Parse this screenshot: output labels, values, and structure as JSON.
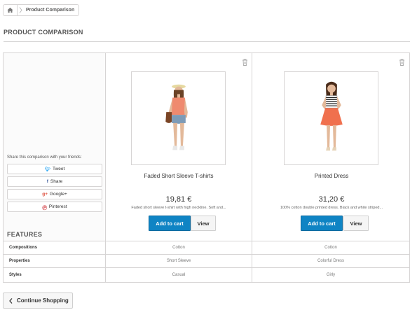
{
  "breadcrumb": {
    "home_icon": "home-icon",
    "current": "Product Comparison"
  },
  "page": {
    "title": "PRODUCT COMPARISON"
  },
  "share": {
    "label": "Share this comparison with your friends:",
    "buttons": [
      {
        "icon": "twitter-icon",
        "glyph": "…",
        "label": "Tweet"
      },
      {
        "icon": "facebook-icon",
        "glyph": "f",
        "label": "Share"
      },
      {
        "icon": "google-plus-icon",
        "glyph": "g+",
        "label": "Google+"
      },
      {
        "icon": "pinterest-icon",
        "glyph": "P",
        "label": "Pinterest"
      }
    ]
  },
  "features": {
    "title": "FEATURES",
    "rows": [
      {
        "name": "Compositions",
        "values": [
          "Cotton",
          "Cotton"
        ]
      },
      {
        "name": "Properties",
        "values": [
          "Short Sleeve",
          "Colorful Dress"
        ]
      },
      {
        "name": "Styles",
        "values": [
          "Casual",
          "Girly"
        ]
      }
    ]
  },
  "products": [
    {
      "name": "Faded Short Sleeve T-shirts",
      "price": "19,81 €",
      "description": "Faded short sleeve t-shirt with high neckline. Soft and...",
      "add_to_cart": "Add to cart",
      "view": "View"
    },
    {
      "name": "Printed Dress",
      "price": "31,20 €",
      "description": "100% cotton double printed dress. Black and white striped...",
      "add_to_cart": "Add to cart",
      "view": "View"
    }
  ],
  "continue_shopping": "Continue Shopping",
  "colors": {
    "accent": "#0f84c4",
    "border": "#d6d4d4"
  }
}
